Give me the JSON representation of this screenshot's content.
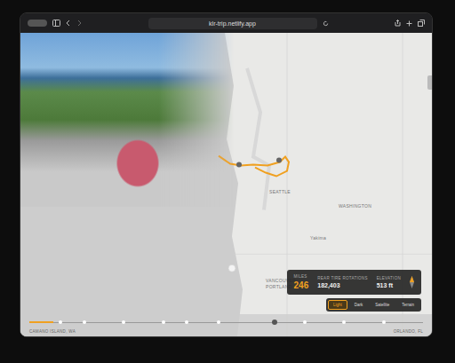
{
  "browser": {
    "url": "klr-trip.netlify.app"
  },
  "map": {
    "labels": [
      {
        "text": "SEATTLE"
      },
      {
        "text": "WASHINGTON"
      },
      {
        "text": "Yakima"
      },
      {
        "text": "VANCOUVER"
      },
      {
        "text": "PORTLAND"
      }
    ]
  },
  "stats": [
    {
      "label": "MILES",
      "value": "246",
      "highlight": true
    },
    {
      "label": "REAR TIRE ROTATIONS",
      "value": "182,403",
      "highlight": false
    },
    {
      "label": "ELEVATION",
      "value": "513 ft",
      "highlight": false
    }
  ],
  "map_styles": [
    {
      "label": "Light",
      "selected": true
    },
    {
      "label": "Dark",
      "selected": false
    },
    {
      "label": "Satellite",
      "selected": false
    },
    {
      "label": "Terrain",
      "selected": false
    }
  ],
  "timeline": {
    "start": "CAMANO ISLAND, WA",
    "end": "ORLANDO, FL",
    "level": 0.06,
    "markers": [
      {
        "selected": false
      },
      {
        "selected": false
      },
      {
        "selected": false
      },
      {
        "selected": false
      },
      {
        "selected": false
      },
      {
        "selected": false
      },
      {
        "selected": true
      },
      {
        "selected": false
      },
      {
        "selected": false
      },
      {
        "selected": false
      }
    ]
  }
}
